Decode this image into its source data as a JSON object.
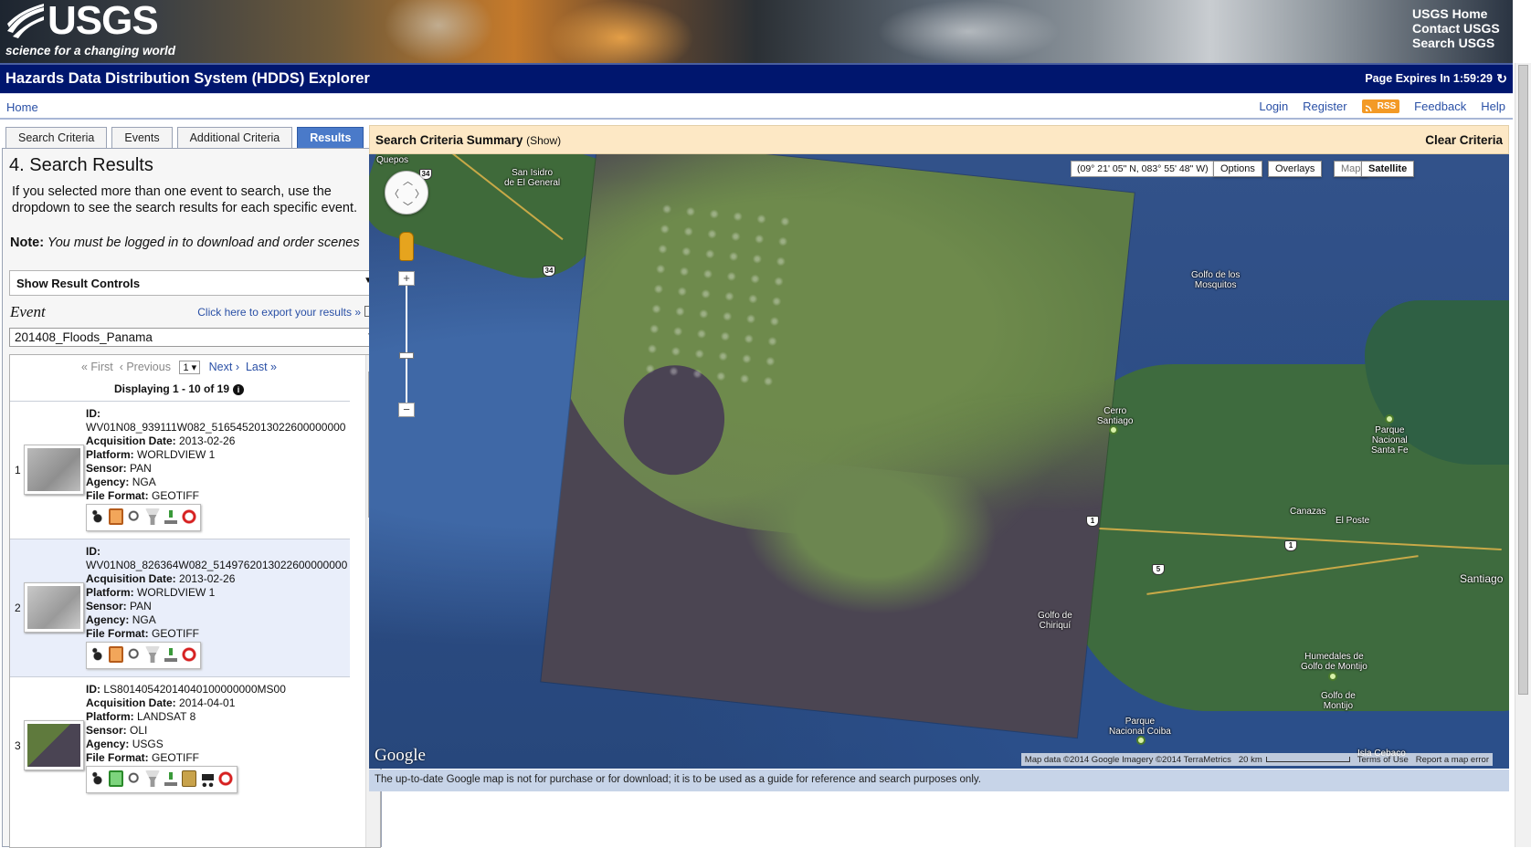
{
  "banner": {
    "logo_word": "USGS",
    "logo_tagline": "science for a changing world",
    "links": [
      "USGS Home",
      "Contact USGS",
      "Search USGS"
    ]
  },
  "titlebar": {
    "title": "Hazards Data Distribution System (HDDS) Explorer",
    "page_expires": "Page Expires In 1:59:29"
  },
  "nav": {
    "home": "Home",
    "login": "Login",
    "register": "Register",
    "rss": "RSS",
    "feedback": "Feedback",
    "help": "Help"
  },
  "tabs": [
    {
      "label": "Search Criteria",
      "active": false
    },
    {
      "label": "Events",
      "active": false
    },
    {
      "label": "Additional Criteria",
      "active": false
    },
    {
      "label": "Results",
      "active": true
    }
  ],
  "panel": {
    "heading": "4. Search Results",
    "intro": "If you selected more than one event to search, use the dropdown to see the search results for each specific event.",
    "note_label": "Note:",
    "note_text": " You must be logged in to download and order scenes",
    "result_controls": "Show Result Controls",
    "event_label": "Event",
    "export_link": "Click here to export your results »",
    "event_selected": "201408_Floods_Panama"
  },
  "pager": {
    "first": "« First",
    "previous": "‹ Previous",
    "page": "1",
    "next": "Next ›",
    "last": "Last »",
    "displaying": "Displaying 1 - 10 of 19"
  },
  "field_labels": {
    "id": "ID:",
    "acquisition": "Acquisition Date:",
    "platform": "Platform:",
    "sensor": "Sensor:",
    "agency": "Agency:",
    "format": "File Format:"
  },
  "results": [
    {
      "num": "1",
      "id": "WV01N08_939111W082_5165452013022600000000",
      "acq": "2013-02-26",
      "platform": "WORLDVIEW 1",
      "sensor": "PAN",
      "agency": "NGA",
      "format": "GEOTIFF"
    },
    {
      "num": "2",
      "id": "WV01N08_826364W082_5149762013022600000000",
      "acq": "2013-02-26",
      "platform": "WORLDVIEW 1",
      "sensor": "PAN",
      "agency": "NGA",
      "format": "GEOTIFF"
    },
    {
      "num": "3",
      "id": "LS80140542014040100000000MS00",
      "acq": "2014-04-01",
      "platform": "LANDSAT 8",
      "sensor": "OLI",
      "agency": "USGS",
      "format": "GEOTIFF"
    }
  ],
  "map": {
    "summary_title": "Search Criteria Summary",
    "summary_show": "(Show)",
    "clear_criteria": "Clear Criteria",
    "coordinates": "(09° 21' 05\" N, 083° 55' 48\" W)",
    "options": "Options",
    "overlays": "Overlays",
    "map_btn": "Map",
    "satellite_btn": "Satellite",
    "places": {
      "quepos": "Quepos",
      "san_isidro": "San Isidro\nde El General",
      "golfo_mosquitos": "Golfo de los\nMosquitos",
      "cerro_santiago": "Cerro\nSantiago",
      "parque_santa_fe": "Parque\nNacional\nSanta Fe",
      "canazas": "Canazas",
      "el_poste": "El Poste",
      "santiago": "Santiago",
      "golfo_chiriqui": "Golfo de\nChiriquí",
      "humedales": "Humedales de\nGolfo de Montijo",
      "golfo_montijo": "Golfo de\nMontijo",
      "parque_coiba": "Parque\nNacional Coiba",
      "isla_cebaco": "Isla Cebaco"
    },
    "shields": {
      "r34a": "34",
      "r34b": "34",
      "r1a": "1",
      "r1b": "1",
      "r5": "5"
    },
    "google": "Google",
    "attribution": "Map data ©2014 Google Imagery ©2014 TerraMetrics",
    "scale": "20 km",
    "terms": "Terms of Use",
    "report": "Report a map error",
    "disclaimer": "The up-to-date Google map is not for purchase or for download; it is to be used as a guide for reference and search purposes only."
  }
}
